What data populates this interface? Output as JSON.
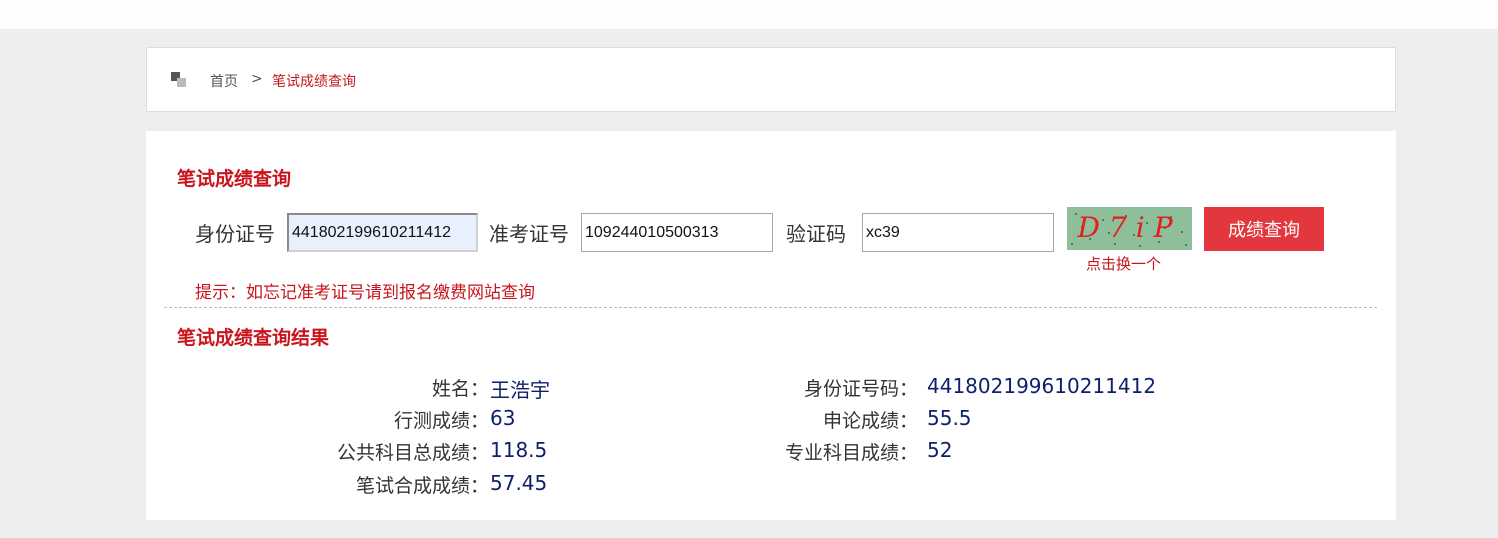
{
  "breadcrumb": {
    "home": "首页",
    "separator": ">",
    "current": "笔试成绩查询"
  },
  "query": {
    "title": "笔试成绩查询",
    "id_label": "身份证号",
    "id_value": "441802199610211412",
    "exam_label": "准考证号",
    "exam_value": "109244010500313",
    "captcha_label": "验证码",
    "captcha_value": "xc39",
    "captcha_image_text": "D7iP",
    "captcha_refresh": "点击换一个",
    "submit_label": "成绩查询",
    "tip": "提示：如忘记准考证号请到报名缴费网站查询"
  },
  "result": {
    "title": "笔试成绩查询结果",
    "name_label": "姓名：",
    "name_value": "王浩宇",
    "id_label": "身份证号码：",
    "id_value": "441802199610211412",
    "xingce_label": "行测成绩：",
    "xingce_value": "63",
    "shenlun_label": "申论成绩：",
    "shenlun_value": "55.5",
    "public_label": "公共科目总成绩：",
    "public_value": "118.5",
    "major_label": "专业科目成绩：",
    "major_value": "52",
    "total_label": "笔试合成成绩：",
    "total_value": "57.45"
  },
  "colors": {
    "accent_red": "#c9151e",
    "button_red": "#e2383d",
    "value_navy": "#0e1f6b"
  }
}
